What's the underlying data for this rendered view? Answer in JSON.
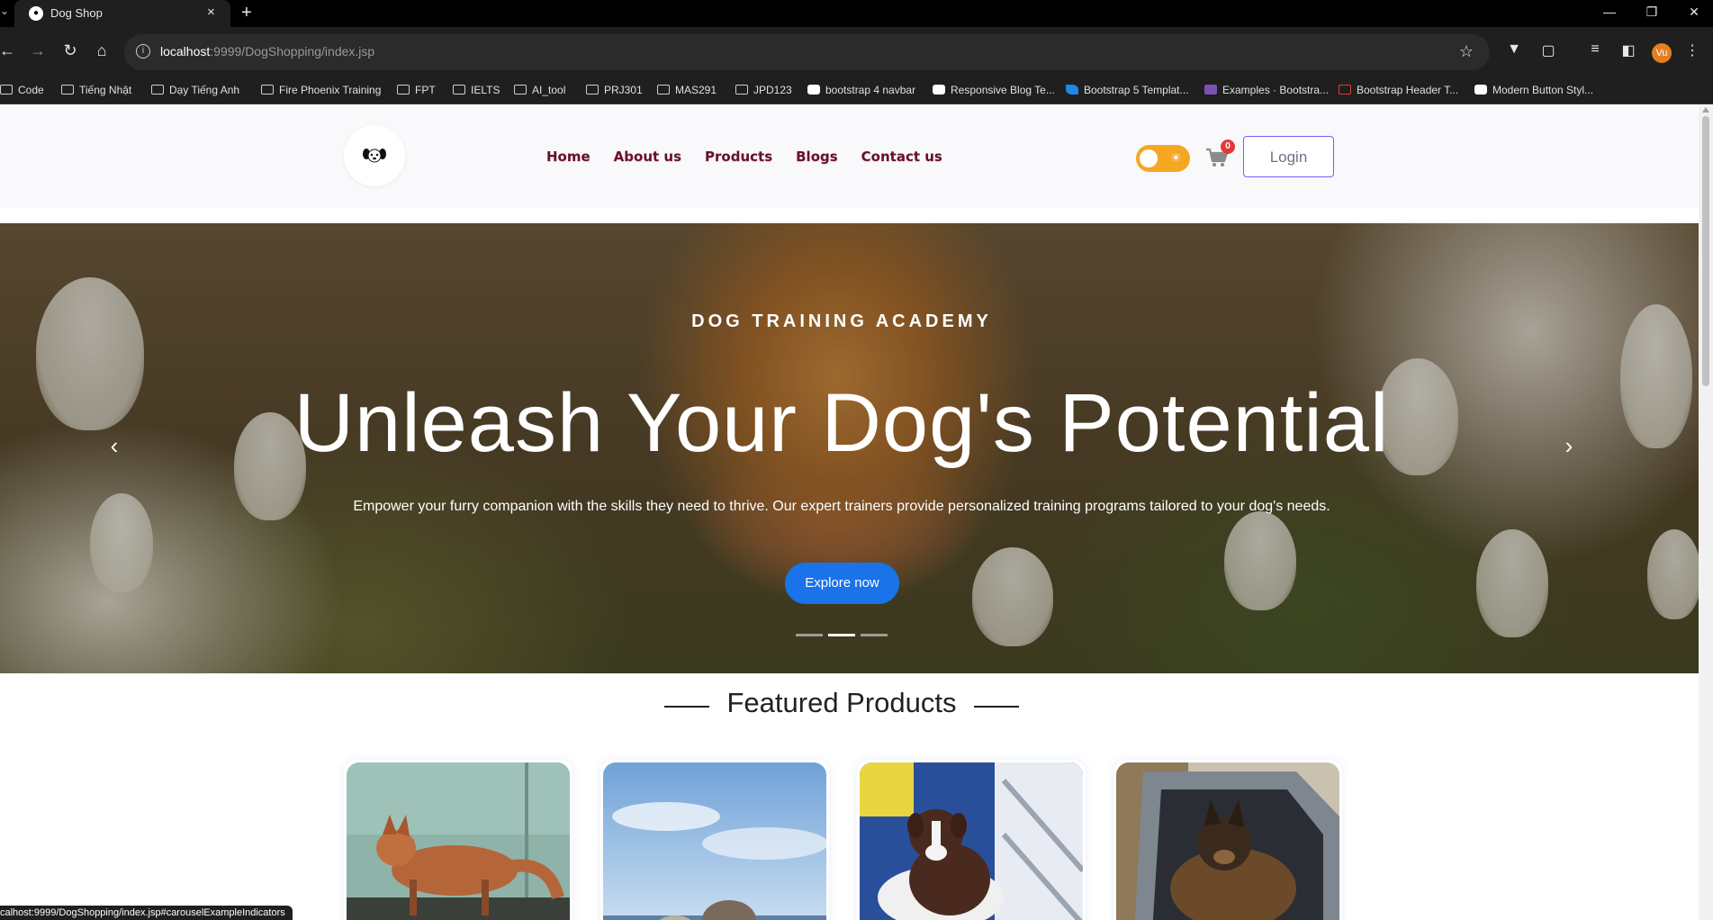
{
  "browser": {
    "tab_title": "Dog Shop",
    "url_host": "localhost",
    "url_rest": ":9999/DogShopping/index.jsp",
    "profile_initials": "Vu",
    "status_url": "calhost:9999/DogShopping/index.jsp#carouselExampleIndicators",
    "bookmarks": [
      {
        "label": "Code",
        "icon": "folder-icon"
      },
      {
        "label": "Tiếng Nhật",
        "icon": "folder-icon"
      },
      {
        "label": "Dạy Tiếng Anh",
        "icon": "folder-icon"
      },
      {
        "label": "Fire Phoenix Training",
        "icon": "folder-icon"
      },
      {
        "label": "FPT",
        "icon": "folder-icon"
      },
      {
        "label": "IELTS",
        "icon": "folder-icon"
      },
      {
        "label": "AI_tool",
        "icon": "folder-icon"
      },
      {
        "label": "PRJ301",
        "icon": "folder-icon"
      },
      {
        "label": "MAS291",
        "icon": "folder-icon"
      },
      {
        "label": "JPD123",
        "icon": "folder-icon"
      },
      {
        "label": "bootstrap 4 navbar",
        "icon": "site-icon"
      },
      {
        "label": "Responsive Blog Te...",
        "icon": "site-icon"
      },
      {
        "label": "Bootstrap 5 Templat...",
        "icon": "arrow-site-icon"
      },
      {
        "label": "Examples · Bootstra...",
        "icon": "bootstrap-icon"
      },
      {
        "label": "Bootstrap Header T...",
        "icon": "red-site-icon"
      },
      {
        "label": "Modern Button Styl...",
        "icon": "site-icon"
      }
    ]
  },
  "header": {
    "nav": [
      "Home",
      "About us",
      "Products",
      "Blogs",
      "Contact us"
    ],
    "cart_count": "0",
    "login_label": "Login",
    "toggle_icon": "sun-icon",
    "accent_color": "#6b0f2a"
  },
  "hero": {
    "eyebrow": "DOG TRAINING ACADEMY",
    "title": "Unleash Your Dog's Potential",
    "text": "Empower your furry companion with the skills they need to thrive. Our expert trainers provide personalized training programs tailored to your dog's needs.",
    "button_label": "Explore now",
    "button_color": "#1a73e8",
    "active_slide": 2,
    "slide_count": 3
  },
  "featured": {
    "title": "Featured Products",
    "products": [
      {
        "image": "red-fox-like-dog"
      },
      {
        "image": "dog-at-beach-sky"
      },
      {
        "image": "black-white-puppy"
      },
      {
        "image": "german-shepherd-in-car"
      }
    ]
  }
}
